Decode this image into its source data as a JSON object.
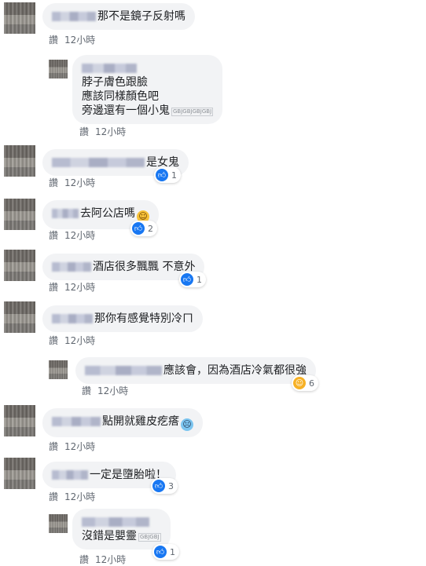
{
  "ui": {
    "like_label": "讚",
    "time_label": "12小時"
  },
  "comments": [
    {
      "text": "那不是鏡子反射嗎"
    },
    {
      "lines": [
        "脖子膚色跟臉",
        "應該同樣顏色吧",
        "旁邊還有一個小鬼"
      ],
      "sticker_text": "GBJGBJGBJGBJ"
    },
    {
      "text": "是女鬼",
      "reactions": "1"
    },
    {
      "text": "去阿公店嗎",
      "reactions": "2"
    },
    {
      "text": "酒店很多飄飄 不意外",
      "reactions": "1"
    },
    {
      "text": "那你有感覺特別冷ㄇ"
    },
    {
      "text": "應該會，因為酒店冷氣都很強",
      "reactions": "6"
    },
    {
      "text": "點開就雞皮疙瘩"
    },
    {
      "text": "一定是墮胎啦！",
      "reactions": "3"
    },
    {
      "text": "沒錯是嬰靈",
      "sticker_text": "GBJGBJ",
      "reactions": "1"
    }
  ],
  "icons": {
    "like": "like-icon",
    "haha": "haha-icon",
    "cold_sweat": "cold-sweat-icon"
  }
}
